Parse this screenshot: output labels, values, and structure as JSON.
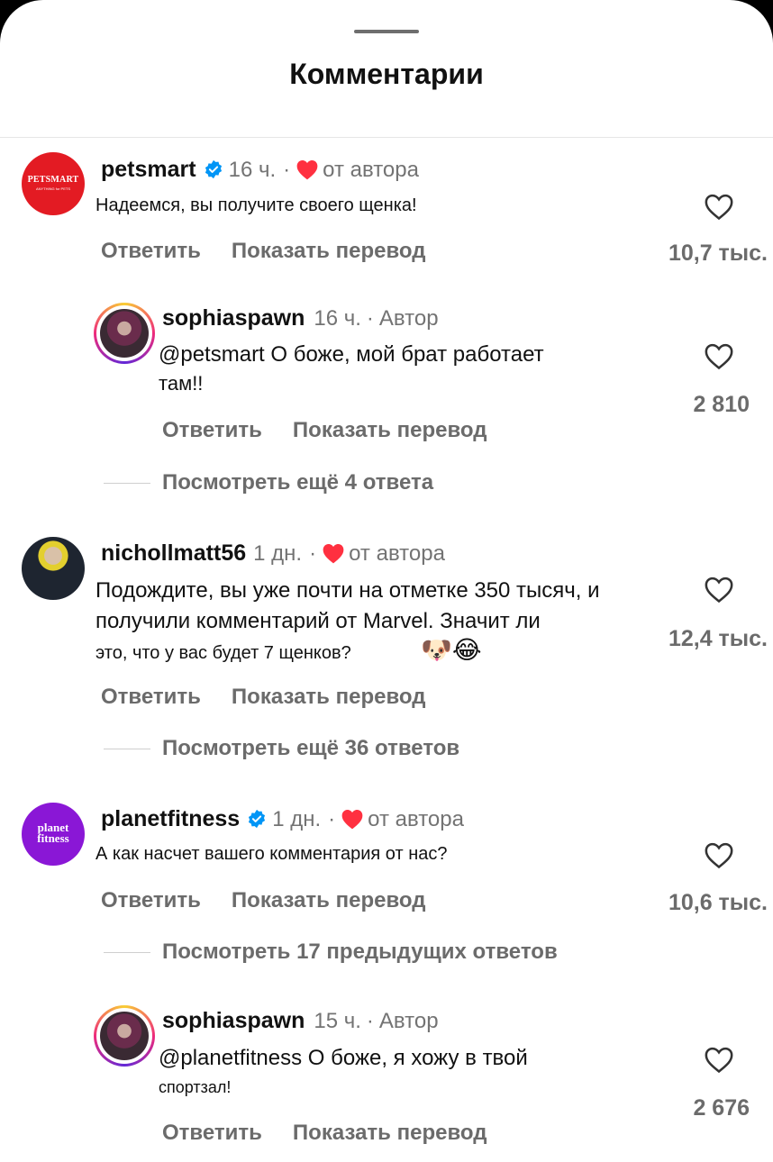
{
  "sheet": {
    "title": "Комментарии"
  },
  "comments": [
    {
      "username": "petsmart",
      "verified": true,
      "time": "16 ч.",
      "author_like": "от автора",
      "text": "Надеемся, вы получите своего щенка!",
      "reply_label": "Ответить",
      "translate_label": "Показать перевод",
      "likes": "10,7 тыс.",
      "avatar_text": "PETSMART",
      "avatar_sub": "ANYTHING for PETS",
      "avatar_color": "#e31b23"
    },
    {
      "username": "sophiaspawn",
      "time": "16 ч.",
      "author_badge": "Автор",
      "text_line1": "@petsmart О боже, мой брат работает",
      "text_line2": "там!!",
      "reply_label": "Ответить",
      "translate_label": "Показать перевод",
      "likes": "2 810",
      "more_replies": "Посмотреть ещё 4 ответа"
    },
    {
      "username": "nichollmatt56",
      "time": "1 дн.",
      "author_like": "от автора",
      "text_line1": "Подождите, вы уже почти на отметке 350 тысяч, и",
      "text_line2": "получили комментарий от Marvel. Значит ли",
      "text_line3": "это, что у вас будет 7 щенков?",
      "emoji": "🐶😂",
      "reply_label": "Ответить",
      "translate_label": "Показать перевод",
      "likes": "12,4 тыс.",
      "more_replies": "Посмотреть ещё 36 ответов"
    },
    {
      "username": "planetfitness",
      "verified": true,
      "time": "1 дн.",
      "author_like": "от автора",
      "text": "А как насчет вашего комментария от нас?",
      "reply_label": "Ответить",
      "translate_label": "Показать перевод",
      "likes": "10,6 тыс.",
      "more_replies": "Посмотреть 17 предыдущих ответов",
      "avatar_text1": "planet",
      "avatar_text2": "fitness",
      "avatar_color": "#8a17d6"
    },
    {
      "username": "sophiaspawn",
      "time": "15 ч.",
      "author_badge": "Автор",
      "text_line1": "@planetfitness О боже, я хожу в твой",
      "text_line2": "спортзал!",
      "reply_label": "Ответить",
      "translate_label": "Показать перевод",
      "likes": "2 676"
    }
  ],
  "separator": "·",
  "colors": {
    "heart_red": "#ff3040",
    "verified_blue": "#0095f6",
    "muted": "#737373"
  },
  "icons": [
    "heart-outline-icon",
    "heart-filled-icon",
    "verified-badge-icon"
  ]
}
